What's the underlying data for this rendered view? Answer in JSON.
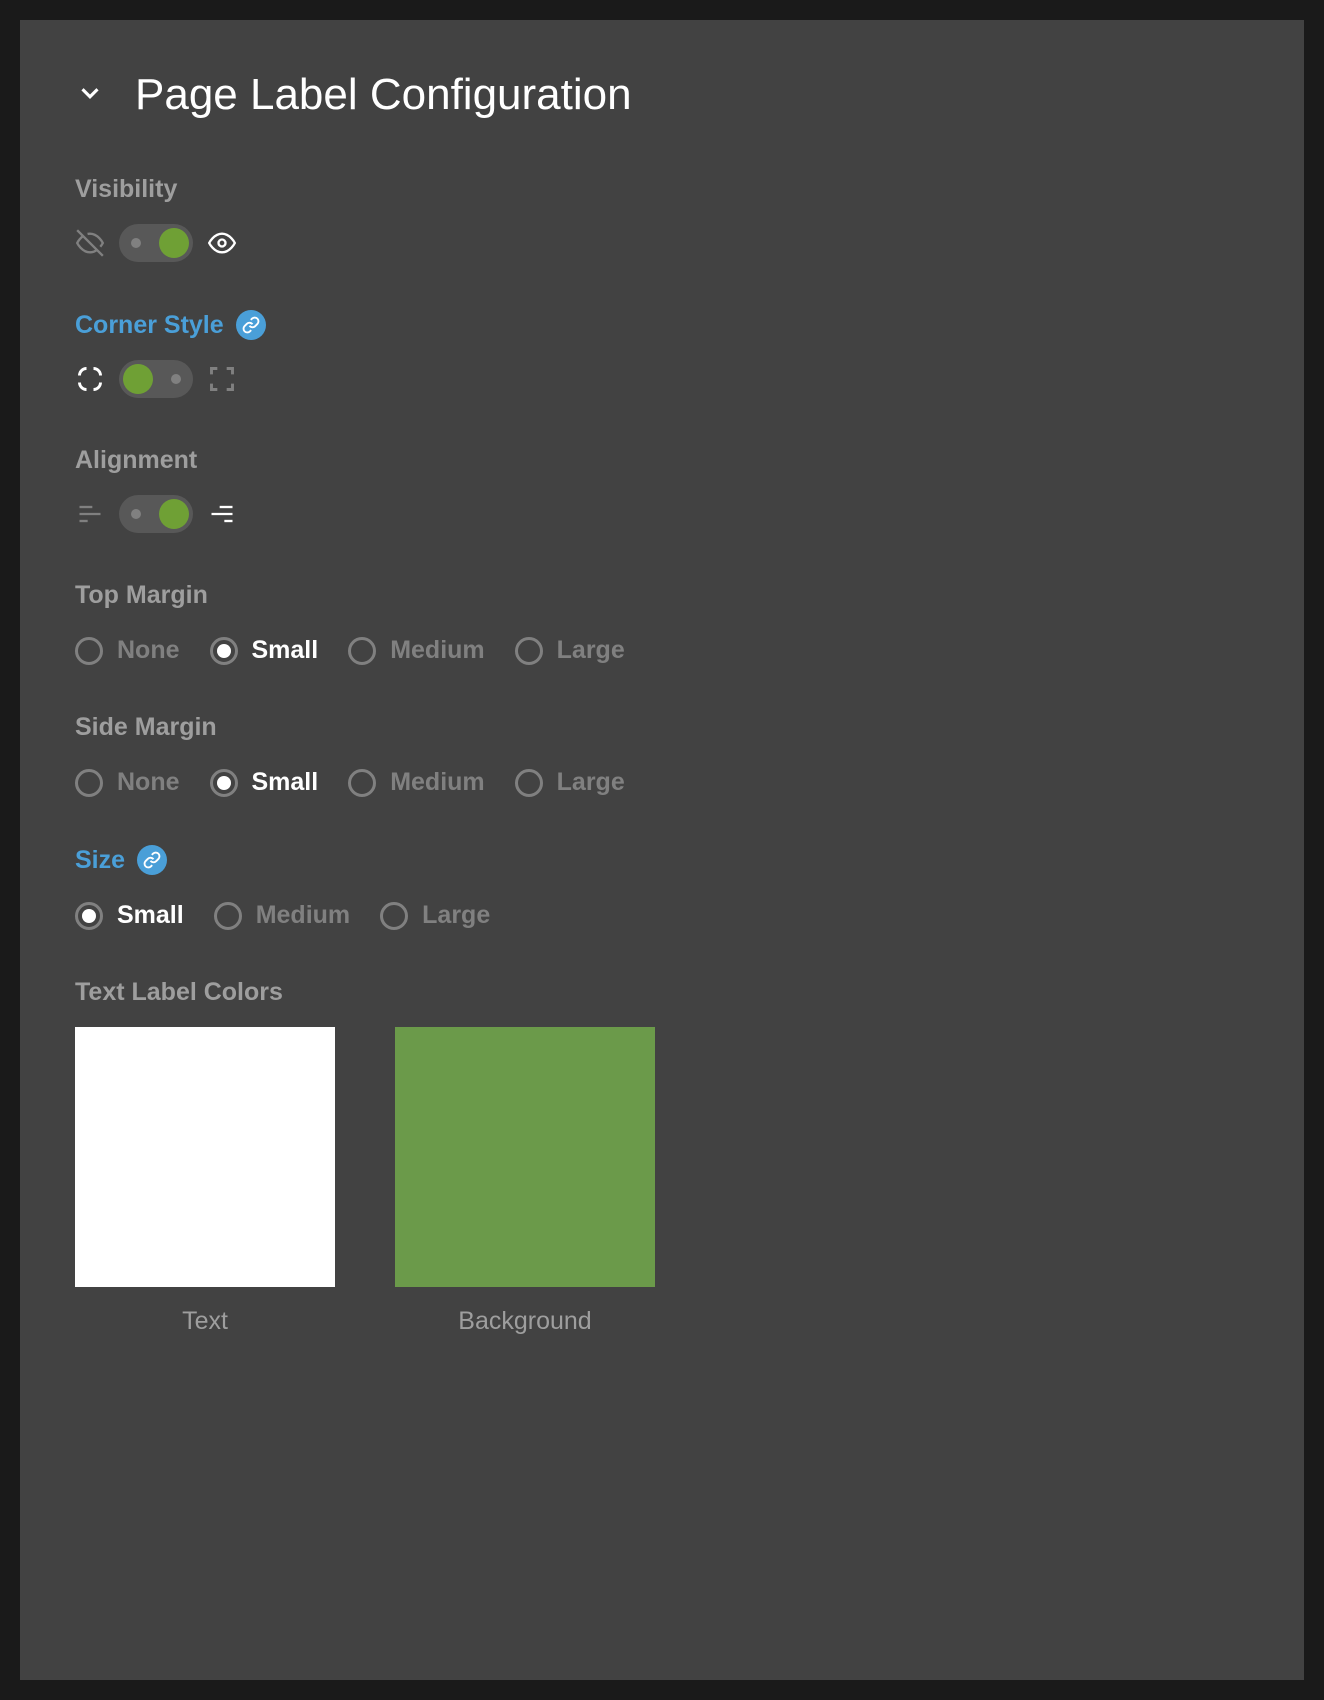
{
  "title": "Page Label Configuration",
  "sections": {
    "visibility": {
      "label": "Visibility",
      "state": "on"
    },
    "cornerStyle": {
      "label": "Corner Style",
      "linked": true,
      "state": "off"
    },
    "alignment": {
      "label": "Alignment",
      "state": "on"
    },
    "topMargin": {
      "label": "Top Margin",
      "options": [
        "None",
        "Small",
        "Medium",
        "Large"
      ],
      "selected": "Small"
    },
    "sideMargin": {
      "label": "Side Margin",
      "options": [
        "None",
        "Small",
        "Medium",
        "Large"
      ],
      "selected": "Small"
    },
    "size": {
      "label": "Size",
      "linked": true,
      "options": [
        "Small",
        "Medium",
        "Large"
      ],
      "selected": "Small"
    },
    "textLabelColors": {
      "label": "Text Label Colors",
      "swatches": [
        {
          "label": "Text",
          "color": "#ffffff"
        },
        {
          "label": "Background",
          "color": "#6b9a4a"
        }
      ]
    }
  }
}
